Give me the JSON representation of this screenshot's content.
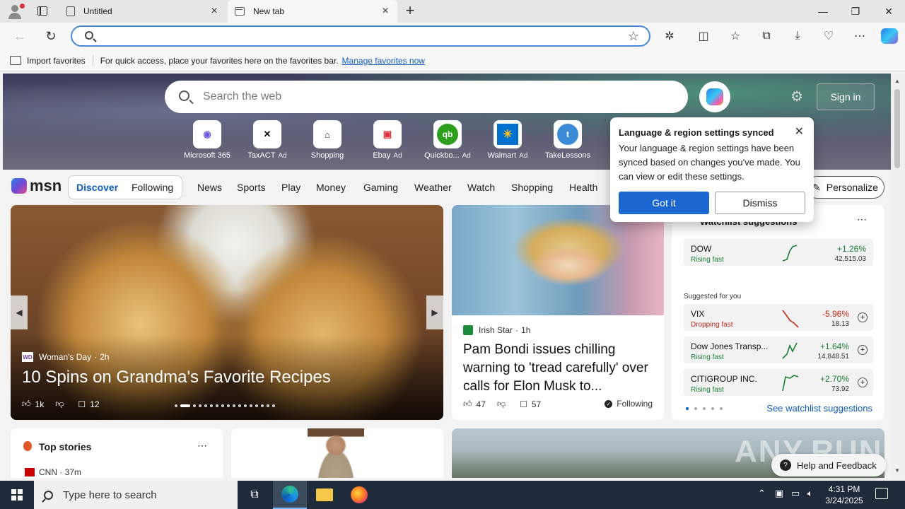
{
  "browser": {
    "tabs": [
      {
        "label": "Untitled"
      },
      {
        "label": "New tab"
      }
    ],
    "address": {
      "value": "",
      "placeholder": ""
    },
    "favorites_bar": {
      "import_label": "Import favorites",
      "hint": "For quick access, place your favorites here on the favorites bar.",
      "manage_link": "Manage favorites now"
    }
  },
  "newtab": {
    "search_placeholder": "Search the web",
    "signin_label": "Sign in",
    "quick_links": [
      {
        "label": "Microsoft 365",
        "ad": ""
      },
      {
        "label": "TaxACT",
        "ad": "Ad"
      },
      {
        "label": "Shopping",
        "ad": ""
      },
      {
        "label": "Ebay",
        "ad": "Ad"
      },
      {
        "label": "Quickbo...",
        "ad": "Ad"
      },
      {
        "label": "Walmart",
        "ad": "Ad"
      },
      {
        "label": "TakeLessons",
        "ad": ""
      }
    ],
    "msn": {
      "logo": "msn",
      "pill": [
        "Discover",
        "Following"
      ],
      "nav": [
        "News",
        "Sports",
        "Play",
        "Money",
        "Gaming",
        "Weather",
        "Watch",
        "Shopping",
        "Health"
      ],
      "personalize": "Personalize"
    },
    "hero_card": {
      "source": "Woman's Day",
      "source_logo": "WD",
      "age": "2h",
      "title": "10 Spins on Grandma's Favorite Recipes",
      "likes": "1k",
      "comments": "12"
    },
    "news_card": {
      "source": "Irish Star",
      "age": "1h",
      "title": "Pam Bondi issues chilling warning to 'tread carefully' over calls for Elon Musk to...",
      "likes": "47",
      "comments": "57",
      "follow": "Following"
    },
    "watchlist": {
      "title": "Watchlist suggestions",
      "suggested_label": "Suggested for you",
      "see_more": "See watchlist suggestions",
      "stocks": [
        {
          "name": "DOW",
          "status": "Rising fast",
          "pct": "+1.26%",
          "value": "42,515.03",
          "up": true
        },
        {
          "name": "VIX",
          "status": "Dropping fast",
          "pct": "-5.96%",
          "value": "18.13",
          "up": false
        },
        {
          "name": "Dow Jones Transp...",
          "status": "Rising fast",
          "pct": "+1.64%",
          "value": "14,848.51",
          "up": true
        },
        {
          "name": "CITIGROUP INC.",
          "status": "Rising fast",
          "pct": "+2.70%",
          "value": "73.92",
          "up": true
        }
      ]
    },
    "top_stories": {
      "title": "Top stories",
      "first_source": "CNN · 37m"
    },
    "popup": {
      "title": "Language & region settings synced",
      "body": "Your language & region settings have been synced based on changes you've made. You can view or edit these settings.",
      "primary": "Got it",
      "secondary": "Dismiss"
    },
    "help_label": "Help and Feedback",
    "watermark": "ANY.RUN"
  },
  "taskbar": {
    "search_placeholder": "Type here to search",
    "time": "4:31 PM",
    "date": "3/24/2025"
  },
  "colors": {
    "accent": "#1a67d2",
    "up": "#1a7f37",
    "down": "#c42b1c"
  }
}
